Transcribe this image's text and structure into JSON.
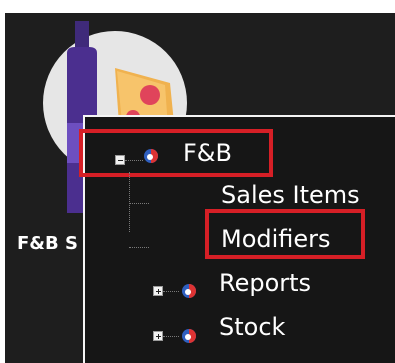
{
  "app": {
    "tile_label": "F&B S"
  },
  "tree": {
    "root": {
      "label": "F&B",
      "expanded": true
    },
    "children": [
      {
        "label": "Sales Items"
      },
      {
        "label": "Modifiers"
      }
    ],
    "siblings": [
      {
        "label": "Reports",
        "expanded": false
      },
      {
        "label": "Stock",
        "expanded": false
      }
    ]
  },
  "colors": {
    "highlight": "#d61f26",
    "background": "#1e1e1e",
    "text": "#ffffff"
  }
}
